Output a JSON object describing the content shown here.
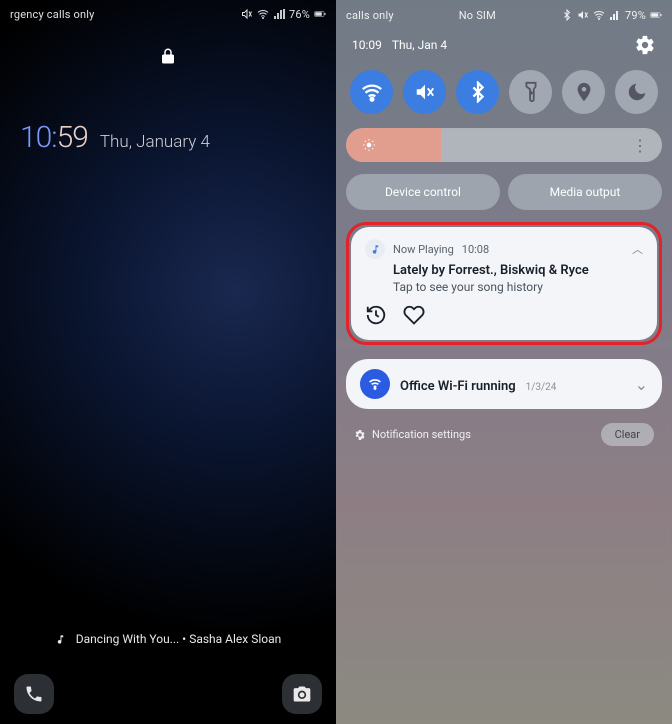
{
  "left": {
    "status_carrier": "rgency calls only",
    "status_battery": "76%",
    "clock_hours": "10:",
    "clock_minutes": "59",
    "clock_date": "Thu, January 4",
    "now_playing": "Dancing With You... • Sasha Alex Sloan"
  },
  "right": {
    "status_carrier": "calls only",
    "status_sim": "No SIM",
    "status_battery": "79%",
    "shade_time": "10:09",
    "shade_date": "Thu, Jan 4",
    "qs": [
      {
        "name": "wifi",
        "active": true
      },
      {
        "name": "mute",
        "active": true
      },
      {
        "name": "bluetooth",
        "active": true
      },
      {
        "name": "flashlight",
        "active": false
      },
      {
        "name": "location",
        "active": false
      },
      {
        "name": "dnd",
        "active": false
      }
    ],
    "brightness_pct": 30,
    "device_control": "Device control",
    "media_output": "Media output",
    "notif1": {
      "app": "Now Playing",
      "ts": "10:08",
      "title": "Lately by Forrest., Biskwiq & Ryce",
      "subtitle": "Tap to see your song history"
    },
    "notif2": {
      "title": "Office Wi-Fi running",
      "date": "1/3/24"
    },
    "settings_label": "Notification settings",
    "clear_label": "Clear"
  },
  "colors": {
    "highlight": "#e3222a",
    "qs_active": "#3b7de0"
  }
}
